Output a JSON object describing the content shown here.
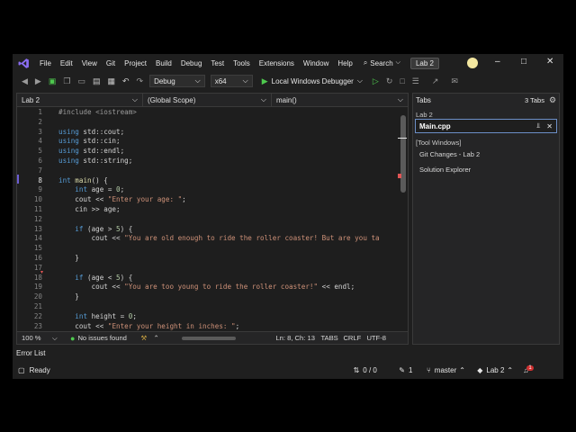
{
  "menu": {
    "items": [
      "File",
      "Edit",
      "View",
      "Git",
      "Project",
      "Build",
      "Debug",
      "Test",
      "Tools",
      "Extensions",
      "Window",
      "Help"
    ],
    "search_label": "Search",
    "solution_name": "Lab 2"
  },
  "toolbar": {
    "config": "Debug",
    "platform": "x64",
    "run_label": "Local Windows Debugger"
  },
  "editor": {
    "file_dropdown": "Lab 2",
    "scope_dropdown": "(Global Scope)",
    "member_dropdown": "main()",
    "lines": [
      {
        "n": "1",
        "t": "#include <iostream>"
      },
      {
        "n": "2",
        "t": ""
      },
      {
        "n": "3",
        "t": "using std::cout;"
      },
      {
        "n": "4",
        "t": "using std::cin;"
      },
      {
        "n": "5",
        "t": "using std::endl;"
      },
      {
        "n": "6",
        "t": "using std::string;"
      },
      {
        "n": "7",
        "t": ""
      },
      {
        "n": "8",
        "t": "int main() {"
      },
      {
        "n": "9",
        "t": "    int age = 0;"
      },
      {
        "n": "10",
        "t": "    cout << \"Enter your age: \";"
      },
      {
        "n": "11",
        "t": "    cin >> age;"
      },
      {
        "n": "12",
        "t": ""
      },
      {
        "n": "13",
        "t": "    if (age > 5) {"
      },
      {
        "n": "14",
        "t": "        cout << \"You are old enough to ride the roller coaster! But are you ta"
      },
      {
        "n": "15",
        "t": ""
      },
      {
        "n": "16",
        "t": "    }"
      },
      {
        "n": "17",
        "t": ""
      },
      {
        "n": "18",
        "t": "    if (age < 5) {"
      },
      {
        "n": "19",
        "t": "        cout << \"You are too young to ride the roller coaster!\" << endl;"
      },
      {
        "n": "20",
        "t": "    }"
      },
      {
        "n": "21",
        "t": ""
      },
      {
        "n": "22",
        "t": "    int height = 0;"
      },
      {
        "n": "23",
        "t": "    cout << \"Enter your height in inches: \";"
      }
    ],
    "zoom": "100 %",
    "issues": "No issues found",
    "position": "Ln: 8, Ch: 13",
    "tabs_mode": "TABS",
    "line_endings": "CRLF",
    "encoding": "UTF-8"
  },
  "tabs_panel": {
    "title": "Tabs",
    "count": "3 Tabs",
    "group_label": "Lab 2",
    "active_tab": "Main.cpp",
    "tool_windows_header": "[Tool Windows]",
    "tool_windows": [
      "Git Changes - Lab 2",
      "Solution Explorer"
    ]
  },
  "bottom": {
    "error_list": "Error List"
  },
  "statusbar": {
    "ready": "Ready",
    "sync": "0 / 0",
    "edits": "1",
    "branch": "master",
    "repo": "Lab 2",
    "notifications": "1"
  },
  "colors": {
    "accent": "#6c5dd3",
    "run_green": "#4ec94e",
    "keyword": "#569cd6",
    "string": "#ce9178",
    "number": "#b5cea8",
    "issues_ok": "#4ec94e",
    "breakpoint_marker": "#e05555"
  }
}
